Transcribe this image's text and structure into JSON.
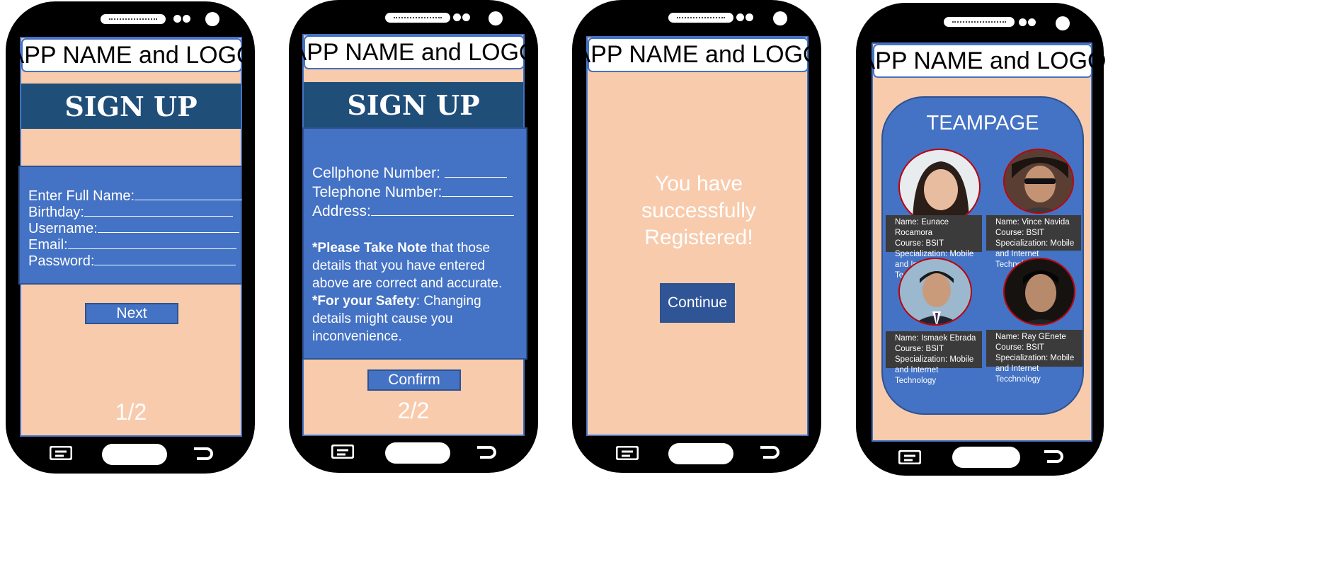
{
  "app_bar_title": "APP NAME and LOGO",
  "screen1": {
    "header": "SIGN UP",
    "fields": [
      "Enter Full Name:",
      "Birthday:",
      "Username:",
      "Email:",
      "Password:"
    ],
    "button": "Next",
    "pager": "1/2"
  },
  "screen2": {
    "header": "SIGN UP",
    "fields": [
      "Cellphone Number:",
      "Telephone Number:",
      "Address:"
    ],
    "note_bold": "*Please Take Note",
    "note_rest": " that  those details that you have entered above are correct and accurate.",
    "safety_bold": "*For your Safety",
    "safety_rest": ": Changing details might cause you inconvenience.",
    "button": "Confirm",
    "pager": "2/2"
  },
  "screen3": {
    "message": "You have successfully Registered!",
    "button": "Continue"
  },
  "screen4": {
    "title": "TEAMPAGE",
    "members": [
      {
        "name": "Name: Eunace Rocamora",
        "course": "Course: BSIT",
        "spec1": "Specialization: Mobile",
        "spec2": "and Internet Technology"
      },
      {
        "name": "Name: Vince Navida",
        "course": "Course: BSIT",
        "spec1": "Specialization: Mobile",
        "spec2": "and Internet Technology"
      },
      {
        "name": "Name: Ismaek Ebrada",
        "course": "Course: BSIT",
        "spec1": "Specialization: Mobile",
        "spec2": "and Internet Technology"
      },
      {
        "name": "Name: Ray GEnete",
        "course": "Course: BSIT",
        "spec1": "Specialization: Mobile",
        "spec2": "and Internet Tecchnology"
      }
    ]
  },
  "colors": {
    "screen_bg": "#f8cbad",
    "panel": "#4472c4",
    "header": "#1f4e79",
    "button_dark": "#2f5597",
    "avatar_border": "#c00000",
    "info_bg": "#3b3b3b"
  },
  "icons": [
    "menu-icon",
    "home-button",
    "back-icon"
  ]
}
